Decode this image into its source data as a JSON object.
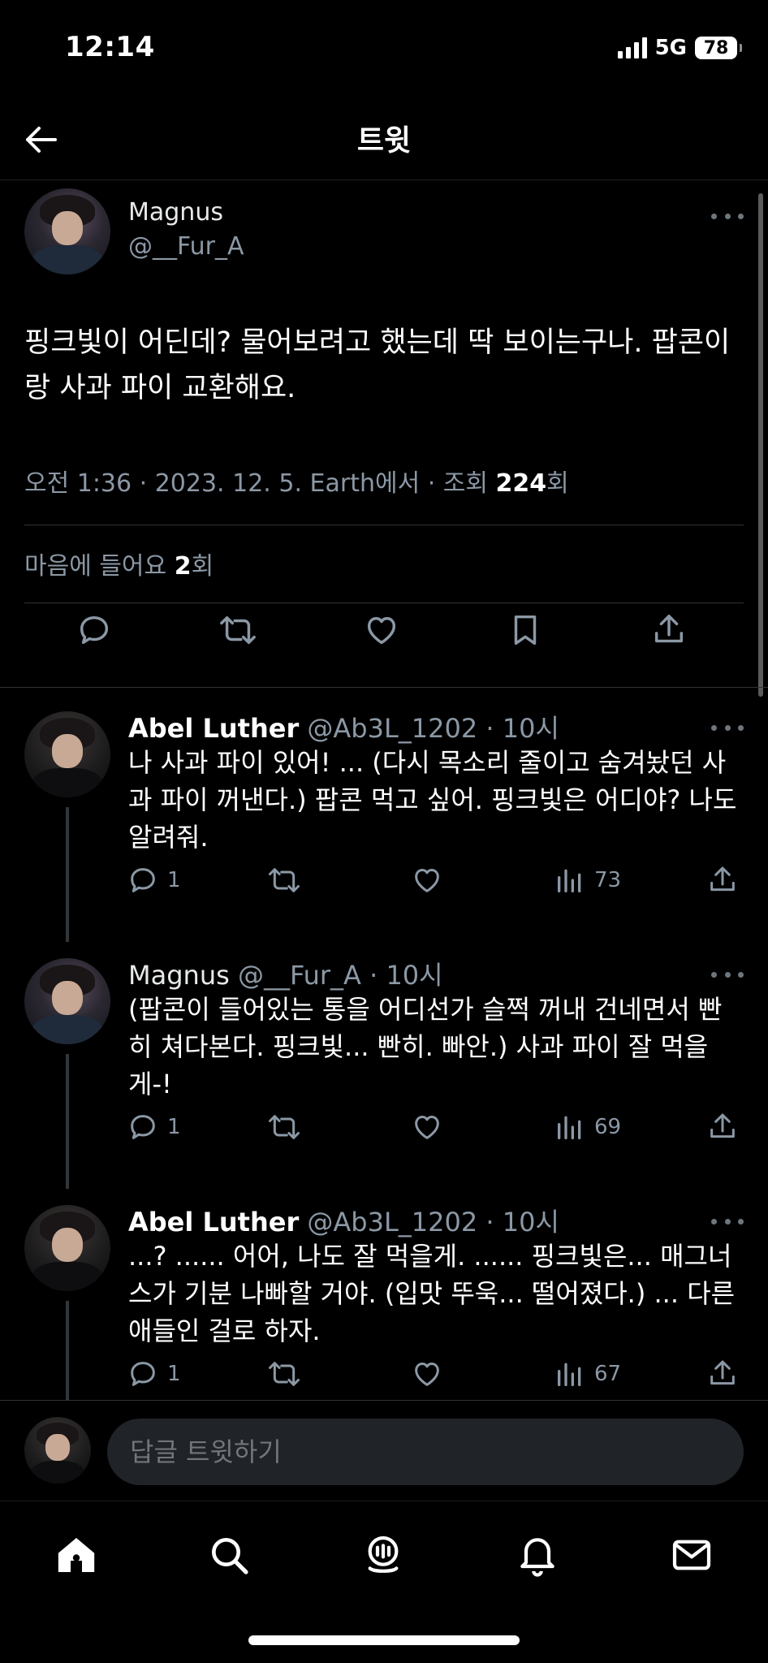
{
  "status_bar": {
    "time": "12:14",
    "network": "5G",
    "battery": "78"
  },
  "nav": {
    "title": "트윗"
  },
  "main_tweet": {
    "author_name": "Magnus",
    "author_handle": "@__Fur_A",
    "text": "핑크빛이 어딘데? 물어보려고 했는데 딱 보이는구나. 팝콘이랑 사과 파이 교환해요.",
    "meta_prefix": "오전 1:36 · 2023. 12. 5. Earth에서 · 조회 ",
    "views": "224",
    "views_suffix": "회",
    "likes_prefix": "마음에 들어요 ",
    "likes": "2",
    "likes_suffix": "회"
  },
  "replies": [
    {
      "name": "Abel Luther",
      "handle": "@Ab3L_1202 · 10시",
      "text": "나 사과 파이 있어! ... (다시 목소리 줄이고 숨겨놨던 사과 파이 꺼낸다.) 팝콘 먹고 싶어. 핑크빛은 어디야? 나도 알려줘.",
      "reply_count": "1",
      "view_count": "73"
    },
    {
      "name": "Magnus",
      "handle": "@__Fur_A · 10시",
      "text": "(팝콘이 들어있는 통을 어디선가 슬쩍 꺼내 건네면서 빤히 쳐다본다. 핑크빛... 빤히. 빠안.) 사과 파이 잘 먹을게-!",
      "reply_count": "1",
      "view_count": "69"
    },
    {
      "name": "Abel Luther",
      "handle": "@Ab3L_1202 · 10시",
      "text": "...? ...... 어어, 나도 잘 먹을게. ...... 핑크빛은... 매그너스가 기분 나빠할 거야. (입맛 뚜욱... 떨어졌다.) ... 다른 애들인 걸로 하자.",
      "reply_count": "1",
      "view_count": "67"
    }
  ],
  "composer": {
    "placeholder": "답글 트윗하기"
  },
  "colors": {
    "background": "#000000",
    "text_primary": "#e7e9ea",
    "text_secondary": "#8b98a5",
    "divider": "#2f3336",
    "input_bg": "#202327"
  },
  "icons": {
    "nav": "back-arrow-icon",
    "actions": [
      "reply-icon",
      "retweet-icon",
      "like-icon",
      "bookmark-icon",
      "share-icon"
    ],
    "reply_actions": [
      "reply-icon",
      "retweet-icon",
      "like-icon",
      "views-icon",
      "share-icon"
    ],
    "tabs": [
      "home-icon",
      "search-icon",
      "spaces-icon",
      "notifications-icon",
      "messages-icon"
    ]
  }
}
